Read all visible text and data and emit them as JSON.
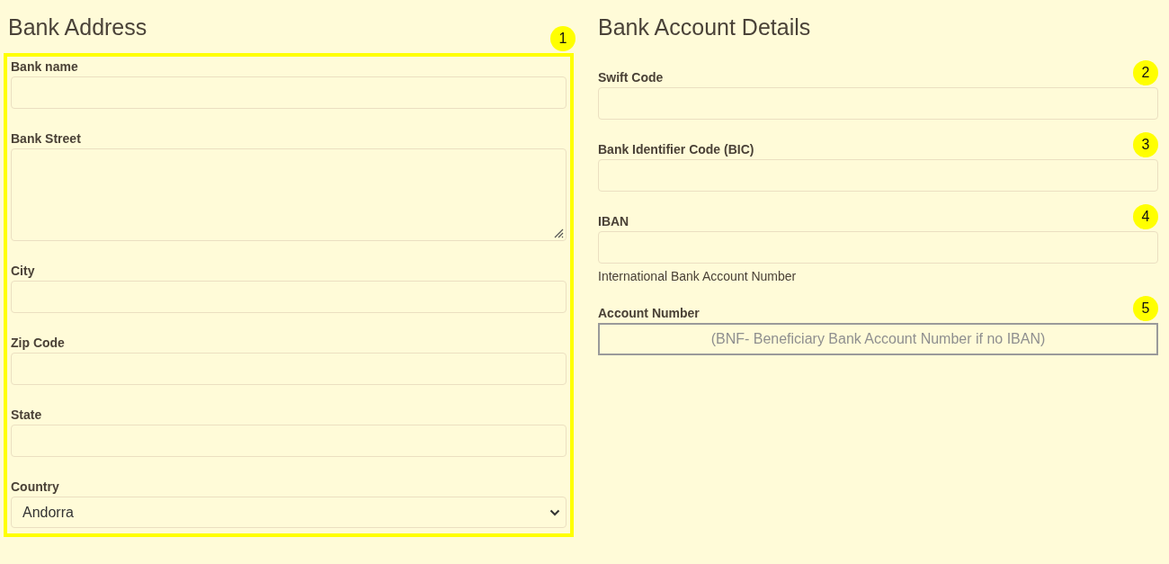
{
  "sections": [
    {
      "title": "Bank Address",
      "highlighted": true,
      "badge": "1",
      "fields": [
        {
          "label": "Bank name",
          "kind": "input"
        },
        {
          "label": "Bank Street",
          "kind": "textarea"
        },
        {
          "label": "City",
          "kind": "input"
        },
        {
          "label": "Zip Code",
          "kind": "input"
        },
        {
          "label": "State",
          "kind": "input"
        },
        {
          "label": "Country",
          "kind": "select",
          "value": "Andorra"
        }
      ]
    },
    {
      "title": "Bank Account Details",
      "highlighted": false,
      "fields": [
        {
          "label": "Swift Code",
          "kind": "input",
          "badge": "2"
        },
        {
          "label": "Bank Identifier Code (BIC)",
          "kind": "input",
          "badge": "3"
        },
        {
          "label": "IBAN",
          "kind": "input",
          "badge": "4",
          "hint": "International Bank Account Number"
        },
        {
          "label": "Account Number",
          "kind": "outlined",
          "badge": "5",
          "placeholder": "(BNF- Beneficiary Bank Account Number if no IBAN)"
        }
      ]
    }
  ]
}
